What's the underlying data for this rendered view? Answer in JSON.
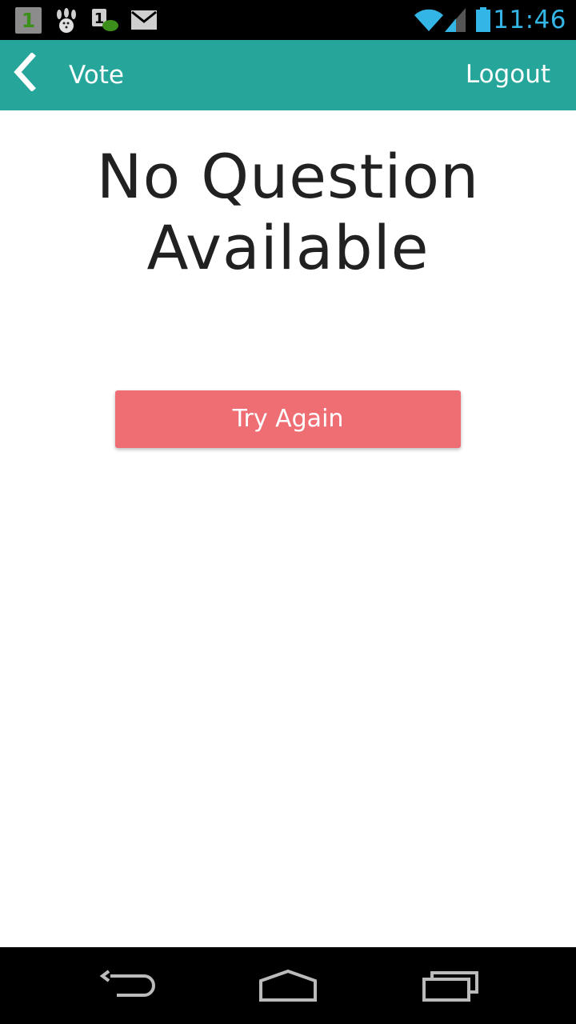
{
  "status_bar": {
    "badge_number": "1",
    "time": "11:46",
    "icons": [
      "number-badge-icon",
      "bowling-icon",
      "chat-notification-icon",
      "mail-icon",
      "wifi-icon",
      "signal-icon",
      "battery-icon"
    ]
  },
  "app_bar": {
    "title": "Vote",
    "logout_label": "Logout",
    "back_icon": "chevron-left-icon"
  },
  "content": {
    "message": "No Question Available",
    "try_again_label": "Try Again"
  },
  "nav_bar": {
    "icons": [
      "back-icon",
      "home-icon",
      "recent-apps-icon"
    ]
  },
  "colors": {
    "app_bar": "#26a69a",
    "button": "#ef6e74",
    "status_time": "#33b5e5",
    "text": "#212121"
  }
}
